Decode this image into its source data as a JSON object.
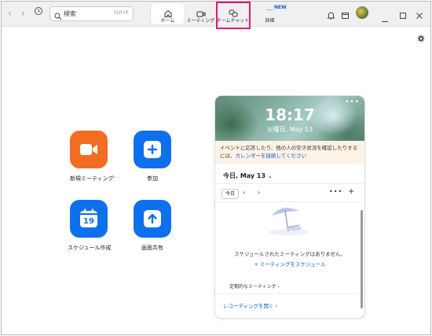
{
  "titlebar": {
    "search_placeholder": "検索",
    "search_shortcut": "Ctrl+F",
    "tabs": [
      {
        "label": "ホーム"
      },
      {
        "label": "ミーティング"
      },
      {
        "label": "チームチャット"
      },
      {
        "label": "詳細",
        "badge": "NEW"
      }
    ]
  },
  "apps": [
    {
      "label": "新規ミーティング",
      "color": "#f26d21",
      "icon": "video-camera-icon"
    },
    {
      "label": "参加",
      "color": "#0e71eb",
      "icon": "plus-icon"
    },
    {
      "label": "スケジュール作成",
      "color": "#0e71eb",
      "icon": "calendar-icon",
      "day": "19"
    },
    {
      "label": "画面共有",
      "color": "#0e71eb",
      "icon": "share-up-arrow-icon"
    }
  ],
  "calendar": {
    "time": "18:17",
    "date": "火曜日, May 13",
    "notice_text": "イベントに応答したり、他の人の空き状況を確認したりするには、",
    "notice_link": "カレンダーを接続してください",
    "today_heading": "今日, May 13",
    "today_button": "今日",
    "empty_text": "スケジュールされたミーティングはありません。",
    "schedule_link": "ミーティングをスケジュール",
    "recurring_label": "定期的なミーティング",
    "recordings_link": "レコーディングを開く"
  },
  "colors": {
    "accent": "#0e5bd8",
    "highlight": "#e2186e",
    "orange": "#f26d21",
    "blue": "#0e71eb"
  }
}
